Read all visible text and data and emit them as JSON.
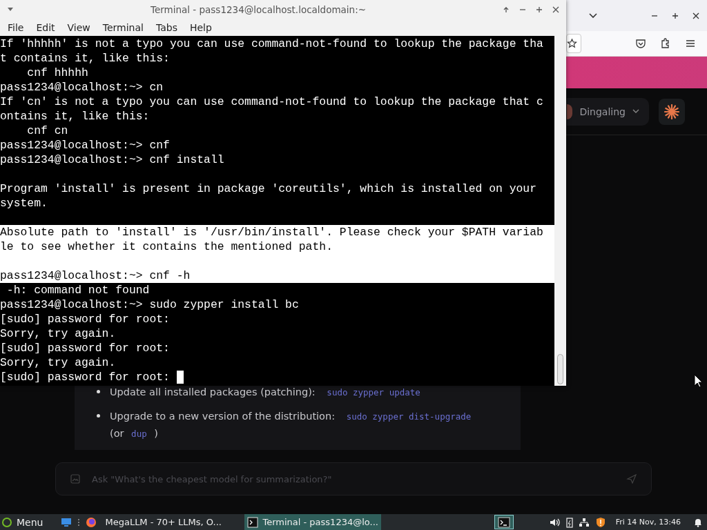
{
  "terminal": {
    "title": "Terminal - pass1234@localhost.localdomain:~",
    "menu": [
      "File",
      "Edit",
      "View",
      "Terminal",
      "Tabs",
      "Help"
    ],
    "lines": [
      {
        "text": "If 'hhhhh' is not a typo you can use command-not-found to lookup the package tha",
        "selected": false
      },
      {
        "text": "t contains it, like this:",
        "selected": false
      },
      {
        "text": "    cnf hhhhh",
        "selected": false
      },
      {
        "text": "pass1234@localhost:~> cn",
        "selected": false
      },
      {
        "text": "If 'cn' is not a typo you can use command-not-found to lookup the package that c",
        "selected": false
      },
      {
        "text": "ontains it, like this:",
        "selected": false
      },
      {
        "text": "    cnf cn",
        "selected": false
      },
      {
        "text": "pass1234@localhost:~> cnf",
        "selected": false
      },
      {
        "text": "pass1234@localhost:~> cnf install",
        "selected": false
      },
      {
        "selected": false
      },
      {
        "text": "Program 'install' is present in package 'coreutils', which is installed on your",
        "selected": false
      },
      {
        "text": "system.",
        "selected": false
      },
      {
        "selected": false
      },
      {
        "text": "Absolute path to 'install' is '/usr/bin/install'. Please check your $PATH variab",
        "selected": true
      },
      {
        "text": "le to see whether it contains the mentioned path.",
        "selected": true
      },
      {
        "selected": true
      },
      {
        "text": "pass1234@localhost:~> cnf -h",
        "selected": true
      },
      {
        "text": " -h: command not found",
        "selected": false
      },
      {
        "text": "pass1234@localhost:~> sudo zypper install bc",
        "selected": false
      },
      {
        "text": "[sudo] password for root:",
        "selected": false
      },
      {
        "text": "Sorry, try again.",
        "selected": false
      },
      {
        "text": "[sudo] password for root:",
        "selected": false
      },
      {
        "text": "Sorry, try again.",
        "selected": false
      },
      {
        "text": "[sudo] password for root:",
        "selected": false,
        "cursor": true
      }
    ]
  },
  "browser": {
    "profile": {
      "name": "Dingaling"
    },
    "bullets": [
      {
        "text": "Update all installed packages (patching):",
        "code": "sudo zypper update"
      },
      {
        "text": "Upgrade to a new version of the distribution:",
        "code": "sudo zypper dist-upgrade",
        "note_open": "(or",
        "note_code": "dup",
        "note_close": ")"
      }
    ],
    "chat_input": {
      "placeholder": "Ask \"What's the cheapest model for summarization?\""
    }
  },
  "taskbar": {
    "menu": "Menu",
    "tasks": [
      {
        "label": "MegaLLM - 70+ LLMs, O...",
        "kind": "browser",
        "selected": false
      },
      {
        "label": "Terminal - pass1234@lo...",
        "kind": "terminal",
        "selected": true
      }
    ],
    "clock": "Fri 14 Nov, 13:46"
  }
}
